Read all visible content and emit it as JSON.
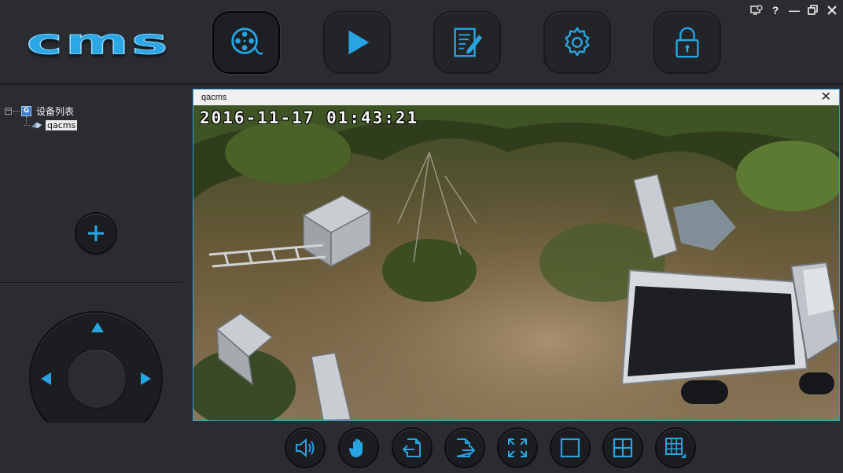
{
  "app": {
    "logo_text": "cms",
    "colors": {
      "accent": "#27a4e2",
      "background": "#2b2c2f",
      "button": "#1c1d20"
    }
  },
  "nav": [
    {
      "id": "live",
      "icon": "film-reel-icon",
      "active": true
    },
    {
      "id": "playback",
      "icon": "play-icon",
      "active": false
    },
    {
      "id": "log",
      "icon": "notepad-edit-icon",
      "active": false
    },
    {
      "id": "settings",
      "icon": "gear-icon",
      "active": false
    },
    {
      "id": "lock",
      "icon": "padlock-icon",
      "active": false
    }
  ],
  "window_controls": {
    "help": "?",
    "minimize": "—"
  },
  "device_tree": {
    "root_toggle": "−",
    "root_icon": "G",
    "root_label": "设备列表",
    "children": [
      {
        "label": "qacms",
        "selected": true
      }
    ]
  },
  "video": {
    "title": "qacms",
    "close": "✕",
    "osd_timestamp": "2016-11-17  01:43:21"
  },
  "toolbar": [
    {
      "id": "audio",
      "icon": "speaker-icon"
    },
    {
      "id": "ptz",
      "icon": "hand-icon"
    },
    {
      "id": "import",
      "icon": "import-icon"
    },
    {
      "id": "export",
      "icon": "export-icon"
    },
    {
      "id": "fullscreen",
      "icon": "fullscreen-icon"
    },
    {
      "id": "layout1",
      "icon": "single-view-icon"
    },
    {
      "id": "layout4",
      "icon": "quad-view-icon"
    },
    {
      "id": "layout-more",
      "icon": "multi-view-icon"
    }
  ]
}
